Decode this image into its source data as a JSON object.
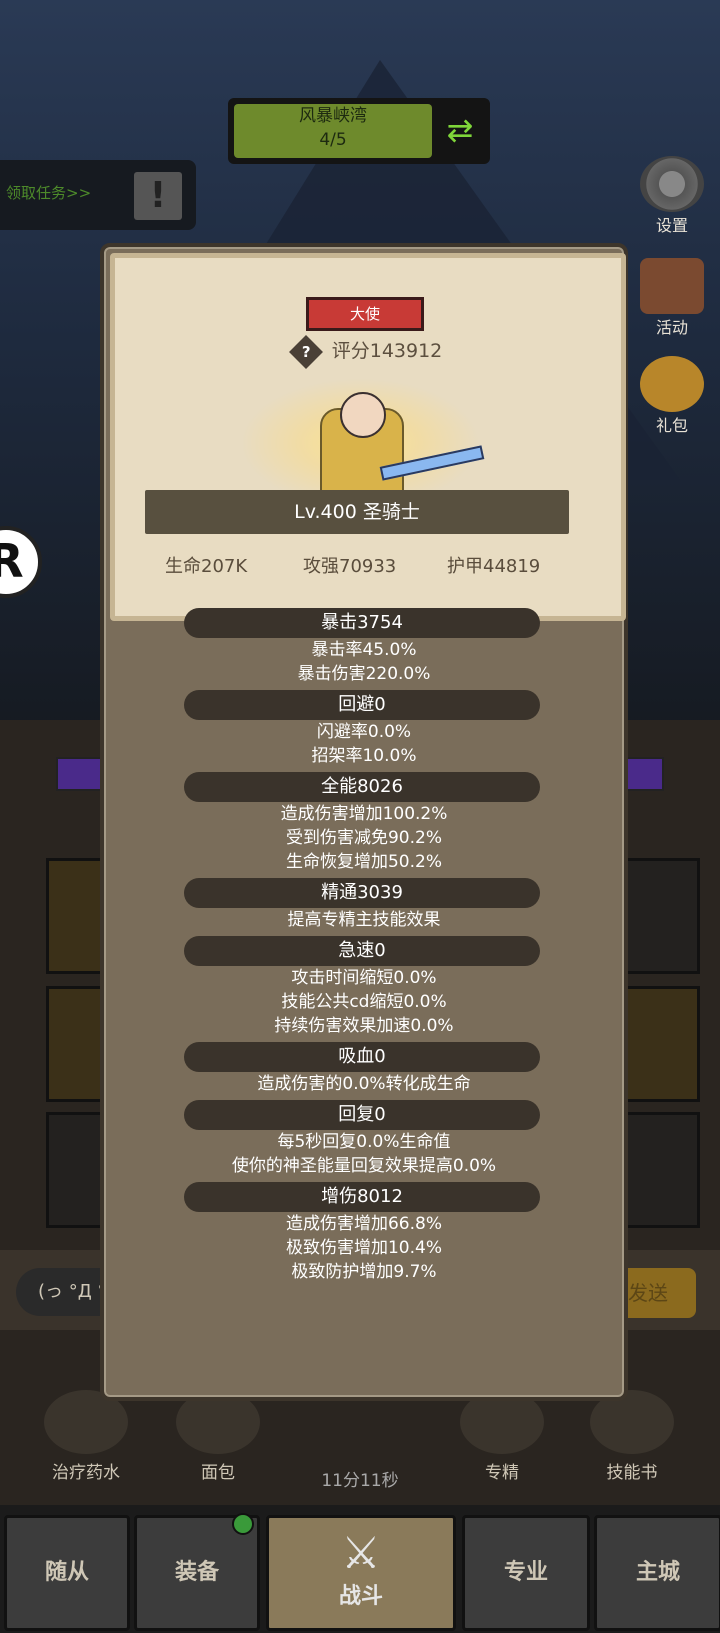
{
  "stage": {
    "name": "风暴峡湾",
    "progress": "4/5"
  },
  "quest": {
    "label": "领取任务>>"
  },
  "side_menu": {
    "settings": "设置",
    "activity": "活动",
    "gift": "礼包"
  },
  "card": {
    "rank": "大使",
    "help_icon": "?",
    "score": "评分143912",
    "class_label": "Lv.400 圣骑士",
    "hp": "生命207K",
    "attack": "攻强70933",
    "armor": "护甲44819"
  },
  "attributes": [
    {
      "head": "暴击3754",
      "subs": [
        "暴击率45.0%",
        "暴击伤害220.0%"
      ]
    },
    {
      "head": "回避0",
      "subs": [
        "闪避率0.0%",
        "招架率10.0%"
      ]
    },
    {
      "head": "全能8026",
      "subs": [
        "造成伤害增加100.2%",
        "受到伤害减免90.2%",
        "生命恢复增加50.2%"
      ]
    },
    {
      "head": "精通3039",
      "subs": [
        "提高专精主技能效果"
      ]
    },
    {
      "head": "急速0",
      "subs": [
        "攻击时间缩短0.0%",
        "技能公共cd缩短0.0%",
        "持续伤害效果加速0.0%"
      ]
    },
    {
      "head": "吸血0",
      "subs": [
        "造成伤害的0.0%转化成生命"
      ]
    },
    {
      "head": "回复0",
      "subs": [
        "每5秒回复0.0%生命值",
        "使你的神圣能量回复效果提高0.0%"
      ]
    },
    {
      "head": "增伤8012",
      "subs": [
        "造成伤害增加66.8%",
        "极致伤害增加10.4%",
        "极致防护增加9.7%"
      ]
    }
  ],
  "chat": {
    "text": "(っ °Д °",
    "send": "发送"
  },
  "items": {
    "potion": "治疗药水",
    "bread": "面包",
    "specialty": "专精",
    "skillbook": "技能书",
    "timer": "11分11秒"
  },
  "nav": {
    "followers": "随从",
    "equipment": "装备",
    "battle": "战斗",
    "profession": "专业",
    "city": "主城"
  }
}
